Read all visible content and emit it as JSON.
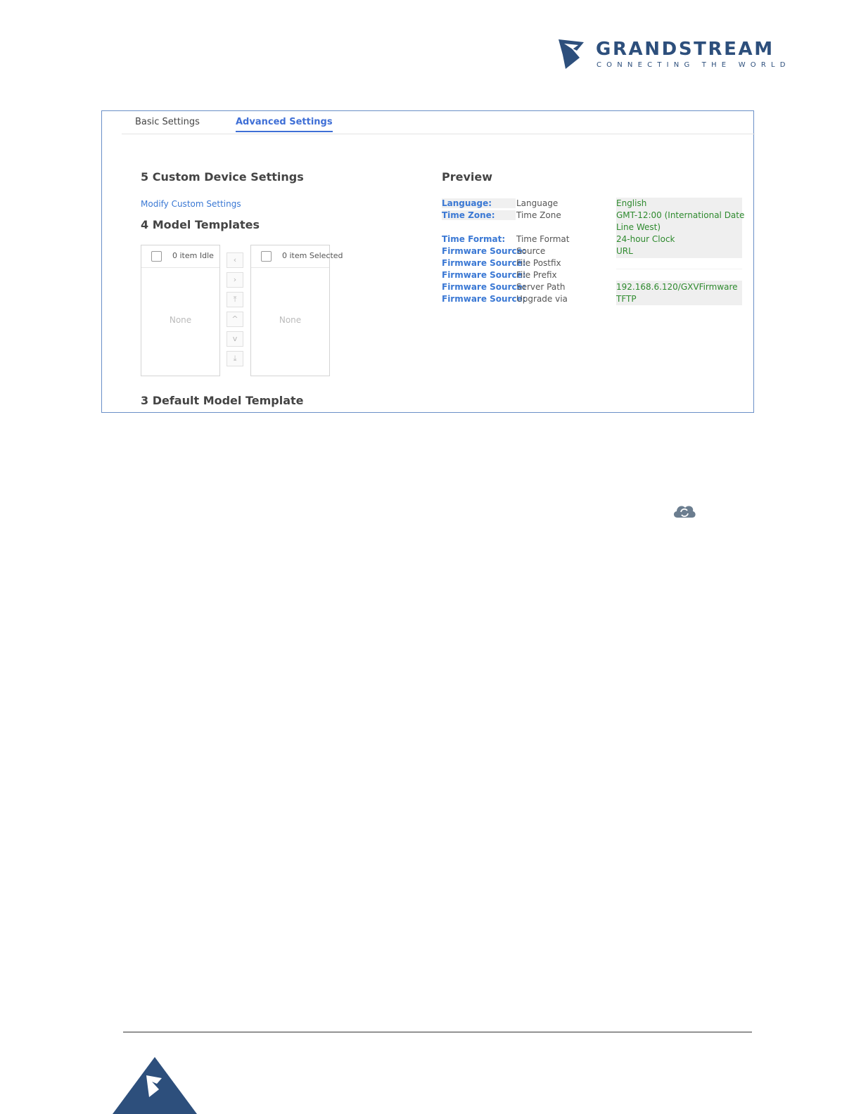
{
  "brand": {
    "name": "GRANDSTREAM",
    "tagline": "CONNECTING THE WORLD",
    "colors": {
      "primary": "#2d4f7c",
      "accent": "#3f6fd6",
      "link": "#3a78d4",
      "value": "#2e8a2e"
    }
  },
  "tabs": [
    {
      "label": "Basic Settings",
      "active": false
    },
    {
      "label": "Advanced Settings",
      "active": true
    }
  ],
  "custom_settings": {
    "heading": "5 Custom Device Settings",
    "modify_link": "Modify Custom Settings"
  },
  "model_templates": {
    "heading": "4 Model Templates",
    "left_list": {
      "title": "0 item Idle",
      "empty": "None"
    },
    "right_list": {
      "title": "0 item Selected",
      "empty": "None"
    },
    "controls": [
      "chevron-left-icon",
      "chevron-right-icon",
      "arrow-top-icon",
      "arrow-up-icon",
      "arrow-down-icon",
      "arrow-bottom-icon"
    ],
    "control_glyphs": [
      "‹",
      "›",
      "⤒",
      "^",
      "v",
      "⤓"
    ]
  },
  "default_template": {
    "heading": "3 Default Model Template"
  },
  "preview": {
    "heading": "Preview",
    "rows": [
      {
        "key": "Language:",
        "field": "Language",
        "value": "English"
      },
      {
        "key": "Time Zone:",
        "field": "Time Zone",
        "value": "GMT-12:00 (International Date"
      },
      {
        "key": "",
        "field": "",
        "value": "Line West)"
      },
      {
        "key": "Time Format:",
        "field": "Time Format",
        "value": "24-hour Clock"
      },
      {
        "key": "Firmware Source:",
        "field": "Source",
        "value": "URL"
      },
      {
        "key": "Firmware Source:",
        "field": "File Postfix",
        "value": ""
      },
      {
        "key": "Firmware Source:",
        "field": "File Prefix",
        "value": ""
      },
      {
        "key": "Firmware Source:",
        "field": "Server Path",
        "value": "192.168.6.120/GXVFirmware"
      },
      {
        "key": "Firmware Source:",
        "field": "Upgrade via",
        "value": "TFTP"
      }
    ]
  },
  "icons": {
    "cloud": "cloud-sync-icon",
    "corner": "grandstream-corner-logo-icon"
  }
}
